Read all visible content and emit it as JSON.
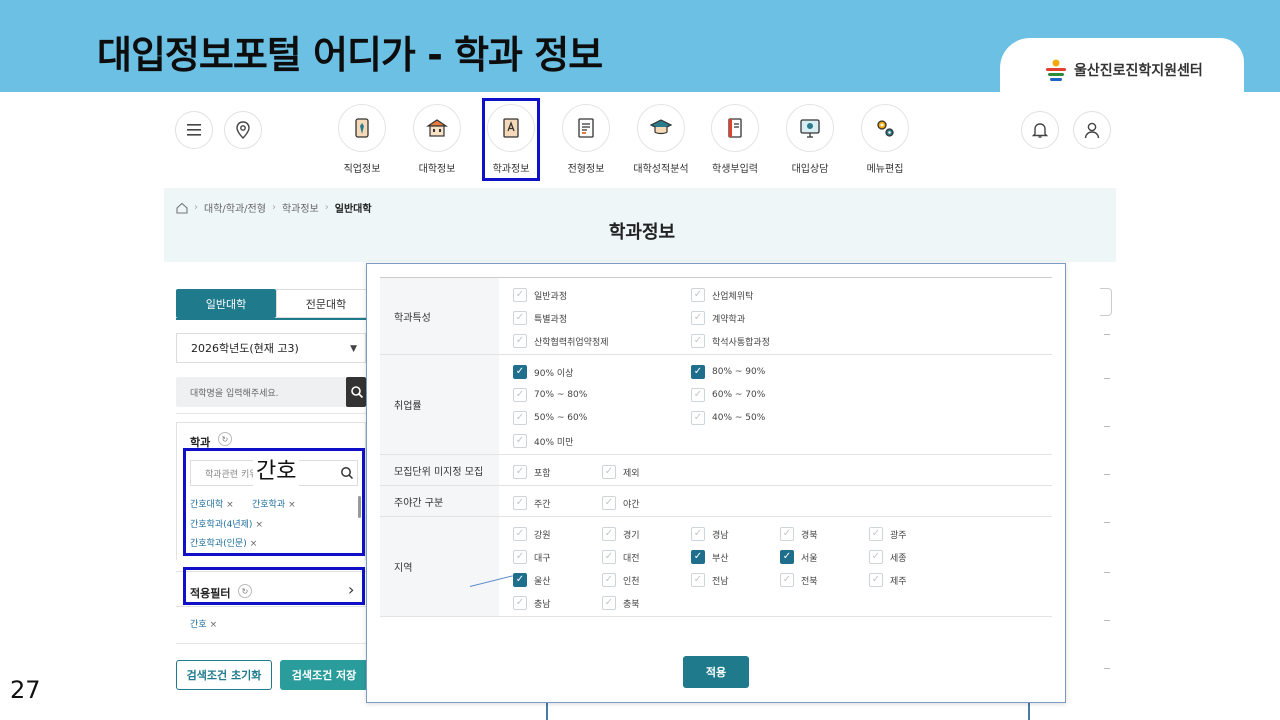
{
  "slide": {
    "title": "대입정보포털 어디가 - 학과 정보",
    "page_number": "27"
  },
  "logo": {
    "text": "울산진로진학지원센터",
    "icon": "ulsan-logo-icon"
  },
  "top_nav": {
    "items": [
      {
        "label": "직업정보",
        "icon": "job-icon"
      },
      {
        "label": "대학정보",
        "icon": "university-icon"
      },
      {
        "label": "학과정보",
        "icon": "department-book-icon"
      },
      {
        "label": "전형정보",
        "icon": "document-icon"
      },
      {
        "label": "대학성적분석",
        "icon": "graduation-cap-icon"
      },
      {
        "label": "학생부입력",
        "icon": "notebook-icon"
      },
      {
        "label": "대입상담",
        "icon": "monitor-consult-icon"
      },
      {
        "label": "메뉴편집",
        "icon": "gear-icon"
      }
    ],
    "highlighted": "학과정보"
  },
  "breadcrumb": {
    "items": [
      "대학/학과/전형",
      "학과정보"
    ],
    "current": "일반대학"
  },
  "content_title": "학과정보",
  "left_panel": {
    "tabs": [
      "일반대학",
      "전문대학"
    ],
    "active_tab": "일반대학",
    "year_select": "2026학년도(현재 고3)",
    "uni_search_placeholder": "대학명을 입력해주세요.",
    "dept_section_title": "학과",
    "dept_input_placeholder": "학과관련 키워드",
    "typed_value": "간호",
    "dept_tags": [
      "간호대학",
      "간호학과",
      "간호학과(4년제)",
      "간호학과(인문)"
    ],
    "applied_filter_title": "적용필터",
    "applied_tags": [
      "간호"
    ],
    "reset_label": "검색조건 초기화",
    "save_label": "검색조건 저장",
    "remove_symbol": "×"
  },
  "filter_modal": {
    "rows": [
      {
        "label": "학과특성",
        "cols": 2,
        "options": [
          {
            "text": "일반과정",
            "checked": false
          },
          {
            "text": "산업체위탁",
            "checked": false
          },
          {
            "text": "특별과정",
            "checked": false
          },
          {
            "text": "계약학과",
            "checked": false
          },
          {
            "text": "산학협력취업약정제",
            "checked": false
          },
          {
            "text": "학석사통합과정",
            "checked": false
          }
        ]
      },
      {
        "label": "취업률",
        "cols": 2,
        "options": [
          {
            "text": "90% 이상",
            "checked": true
          },
          {
            "text": "80% ~ 90%",
            "checked": true
          },
          {
            "text": "70% ~ 80%",
            "checked": false
          },
          {
            "text": "60% ~ 70%",
            "checked": false
          },
          {
            "text": "50% ~ 60%",
            "checked": false
          },
          {
            "text": "40% ~ 50%",
            "checked": false
          },
          {
            "text": "40% 미만",
            "checked": false
          }
        ]
      },
      {
        "label": "모집단위 미지정 모집",
        "cols": 5,
        "options": [
          {
            "text": "포함",
            "checked": false
          },
          {
            "text": "제외",
            "checked": false
          }
        ]
      },
      {
        "label": "주야간 구분",
        "cols": 5,
        "options": [
          {
            "text": "주간",
            "checked": false
          },
          {
            "text": "야간",
            "checked": false
          }
        ]
      },
      {
        "label": "지역",
        "cols": 5,
        "options": [
          {
            "text": "강원",
            "checked": false
          },
          {
            "text": "경기",
            "checked": false
          },
          {
            "text": "경남",
            "checked": false
          },
          {
            "text": "경북",
            "checked": false
          },
          {
            "text": "광주",
            "checked": false
          },
          {
            "text": "대구",
            "checked": false
          },
          {
            "text": "대전",
            "checked": false
          },
          {
            "text": "부산",
            "checked": true
          },
          {
            "text": "서울",
            "checked": true
          },
          {
            "text": "세종",
            "checked": false
          },
          {
            "text": "울산",
            "checked": true
          },
          {
            "text": "인천",
            "checked": false
          },
          {
            "text": "전남",
            "checked": false
          },
          {
            "text": "전북",
            "checked": false
          },
          {
            "text": "제주",
            "checked": false
          },
          {
            "text": "충남",
            "checked": false
          },
          {
            "text": "충북",
            "checked": false
          }
        ]
      }
    ],
    "apply_label": "적용"
  },
  "colors": {
    "banner": "#6cc0e4",
    "primary": "#1f7a8c",
    "checked": "#1f6f8c",
    "highlight": "#1010c8"
  }
}
